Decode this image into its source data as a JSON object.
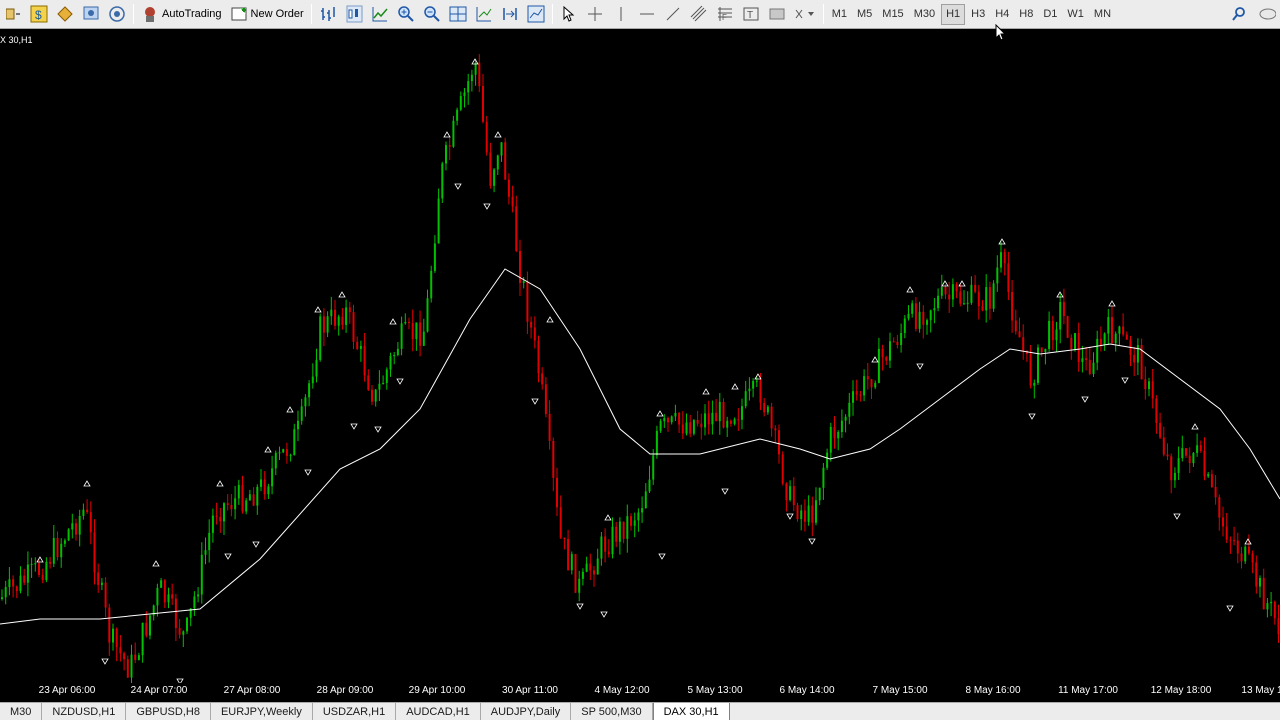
{
  "toolbar": {
    "autotrading_label": "AutoTrading",
    "new_order_label": "New Order",
    "timeframes": [
      "M1",
      "M5",
      "M15",
      "M30",
      "H1",
      "H3",
      "H4",
      "H8",
      "D1",
      "W1",
      "MN"
    ],
    "active_timeframe": "H1"
  },
  "chart": {
    "title": "X 30,H1",
    "time_labels": [
      "23 Apr 06:00",
      "24 Apr 07:00",
      "27 Apr 08:00",
      "28 Apr 09:00",
      "29 Apr 10:00",
      "30 Apr 11:00",
      "4 May 12:00",
      "5 May 13:00",
      "6 May 14:00",
      "7 May 15:00",
      "8 May 16:00",
      "11 May 17:00",
      "12 May 18:00",
      "13 May 1"
    ],
    "colors": {
      "bull": "#00c000",
      "bear": "#e00000",
      "ma": "#ffffff",
      "fractal": "#ffffff",
      "background": "#000000"
    }
  },
  "tabs": {
    "items": [
      "M30",
      "NZDUSD,H1",
      "GBPUSD,H8",
      "EURJPY,Weekly",
      "USDZAR,H1",
      "AUDCAD,H1",
      "AUDJPY,Daily",
      "SP 500,M30",
      "DAX 30,H1"
    ],
    "active": "DAX 30,H1"
  }
}
